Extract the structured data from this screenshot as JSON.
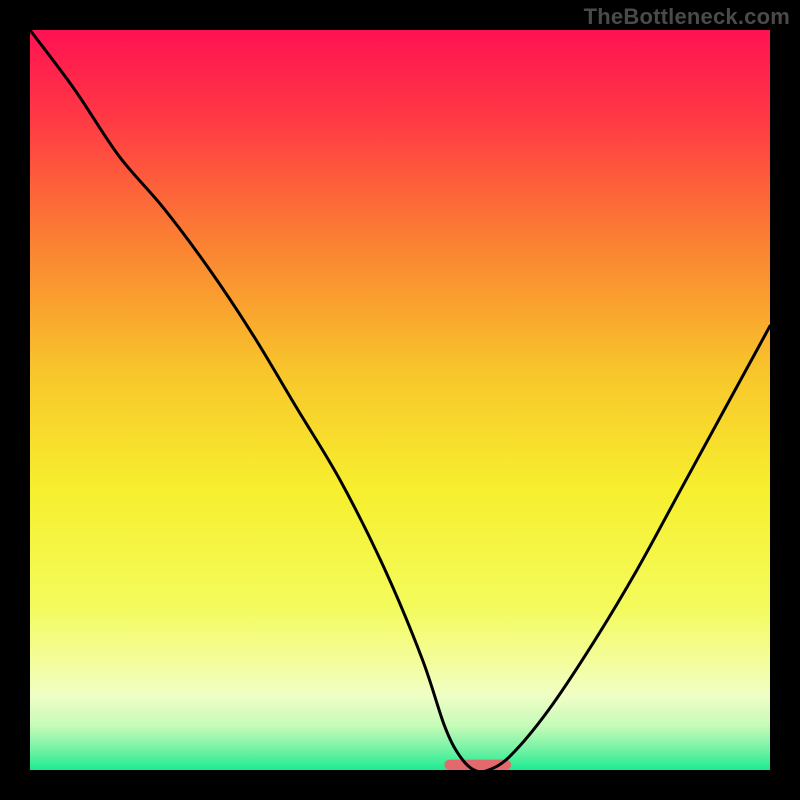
{
  "watermark": "TheBottleneck.com",
  "chart_data": {
    "type": "line",
    "title": "",
    "xlabel": "",
    "ylabel": "",
    "xlim": [
      0,
      100
    ],
    "ylim": [
      0,
      100
    ],
    "grid": false,
    "legend": false,
    "background": {
      "type": "vertical-gradient",
      "stops": [
        {
          "pos": 0,
          "color": "#FF1253"
        },
        {
          "pos": 12,
          "color": "#FF3944"
        },
        {
          "pos": 28,
          "color": "#FB7E33"
        },
        {
          "pos": 46,
          "color": "#F8C52B"
        },
        {
          "pos": 62,
          "color": "#F7EF2E"
        },
        {
          "pos": 78,
          "color": "#F3FB5C"
        },
        {
          "pos": 85,
          "color": "#F4FD99"
        },
        {
          "pos": 90,
          "color": "#EFFEC5"
        },
        {
          "pos": 94,
          "color": "#C7FBB8"
        },
        {
          "pos": 97,
          "color": "#7AF3A7"
        },
        {
          "pos": 100,
          "color": "#1CEB91"
        }
      ]
    },
    "series": [
      {
        "name": "bottleneck-curve",
        "color": "#000000",
        "x": [
          0,
          6,
          12,
          18,
          24,
          30,
          36,
          42,
          48,
          53,
          56,
          58,
          60,
          62,
          65,
          70,
          76,
          82,
          88,
          94,
          100
        ],
        "y": [
          100,
          92,
          83,
          76,
          68,
          59,
          49,
          39,
          27,
          15,
          6,
          2,
          0,
          0,
          2,
          8,
          17,
          27,
          38,
          49,
          60
        ]
      }
    ],
    "markers": [
      {
        "name": "optimal-zone",
        "shape": "rounded-bar",
        "color": "#E26A6C",
        "x_range": [
          56,
          65
        ],
        "y": 0,
        "height_pct": 1.4
      }
    ]
  }
}
